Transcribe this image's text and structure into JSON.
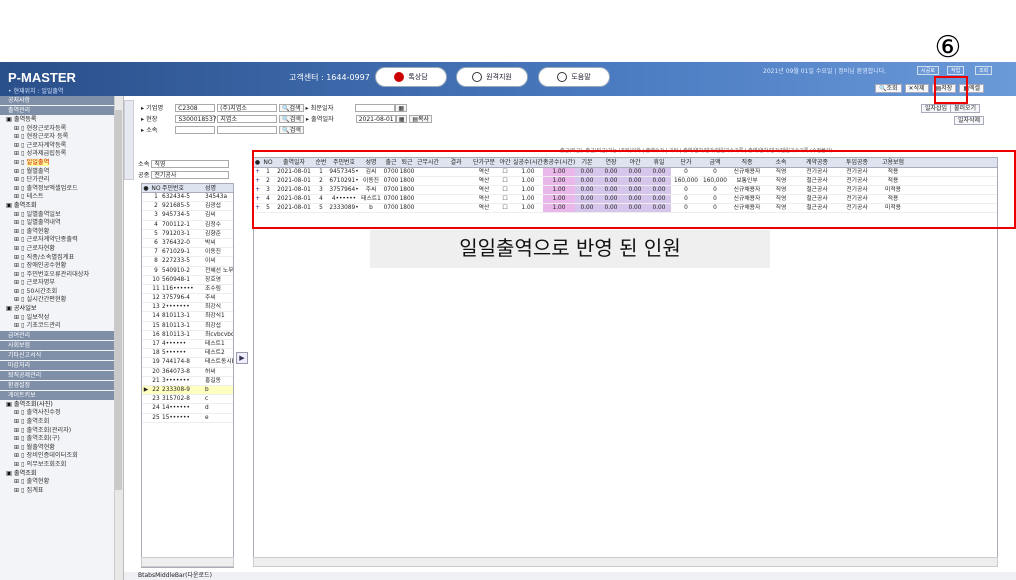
{
  "annotation": {
    "number": "⑥",
    "caption": "일일출역으로 반영 된 인원"
  },
  "header": {
    "app": "P-MASTER",
    "location": "• 현재위치 : 일일출역",
    "callcenter": "고객센터 : 1644-0997",
    "pills": [
      "톡상담",
      "원격지원",
      "도움말"
    ],
    "date": "2021년 09월 01일 수요일 | 정비님 환영합니다.",
    "btns": [
      "시공로",
      "작업",
      "조회"
    ]
  },
  "toolbar": {
    "search": "조회",
    "delete": "삭제",
    "save": "저장",
    "excel": "엑셀",
    "load": "불러오기",
    "rowdel": "일자삭제",
    "insert": "일자삽입"
  },
  "filters": {
    "company_label": "기업명",
    "company_code": "C2308",
    "company_name": "(주)지엽소",
    "site_label": "현장",
    "site_code": "S300018537",
    "site_name": "지엽소",
    "dept_label": "소속",
    "search": "검색",
    "date1_label": "최문일자",
    "date2_label": "출역일자",
    "date2": "2021-08-01",
    "copy": "복사"
  },
  "legend": "출근(퇴근), 출근(퇴근)가능 (조퇴)이하 | 출역수가 | 기타 | 출역/연차/반가/반일기수기록 | 출역/연차/반가/반일기수기록 (수정불가)",
  "left": {
    "dept_label": "소속",
    "dept_value": "직영",
    "trade_label": "공종",
    "trade_value": "전기공사",
    "cols": [
      "NO",
      "주민번호",
      "성명"
    ],
    "rows": [
      [
        "1",
        "632434-5",
        "34543a"
      ],
      [
        "2",
        "921685-5",
        "김광섭"
      ],
      [
        "3",
        "945734-5",
        "김씨"
      ],
      [
        "4",
        "700112-1",
        "김정수"
      ],
      [
        "5",
        "791203-1",
        "김향준"
      ],
      [
        "6",
        "376432-0",
        "박씨"
      ],
      [
        "7",
        "671029-1",
        "이동진"
      ],
      [
        "8",
        "227233-5",
        "이씨"
      ],
      [
        "9",
        "540910-2",
        "전혜선 노무"
      ],
      [
        "10",
        "560948-1",
        "장호영"
      ],
      [
        "11",
        "116••••••",
        "조수림"
      ],
      [
        "12",
        "375796-4",
        "주씨"
      ],
      [
        "13",
        "2•••••••",
        "최강식"
      ],
      [
        "14",
        "810113-1",
        "최강식1"
      ],
      [
        "15",
        "810113-1",
        "최강섭"
      ],
      [
        "16",
        "810113-1",
        "최cvbcvbcv"
      ],
      [
        "17",
        "4••••••",
        "테스트1"
      ],
      [
        "18",
        "5••••••",
        "테스트2"
      ],
      [
        "19",
        "744174-8",
        "테스트동시E"
      ],
      [
        "20",
        "364073-8",
        "허씨"
      ],
      [
        "21",
        "3•••••••",
        "홍길동"
      ],
      [
        "22",
        "233308-9",
        "b"
      ],
      [
        "23",
        "315702-8",
        "c"
      ],
      [
        "24",
        "14••••••",
        "d"
      ],
      [
        "25",
        "15••••••",
        "e"
      ]
    ]
  },
  "grid": {
    "cols": [
      "NO",
      "출역일자",
      "순번",
      "주민번호",
      "성명",
      "출근",
      "퇴근",
      "근무시간",
      "결과",
      "단가구분",
      "야간",
      "실공수(시간)",
      "총공수(시간)",
      "기본",
      "연장",
      "야간",
      "휴일",
      "단가",
      "금액",
      "직종",
      "소속",
      "계약공종",
      "투입공종",
      "고용보험"
    ],
    "rows": [
      [
        "1",
        "2021-08-01",
        "1",
        "9457345•",
        "김씨",
        "0700",
        "1800",
        "",
        "",
        "역산",
        "",
        "1.00",
        "1.00",
        "0.00",
        "0.00",
        "0.00",
        "0.00",
        "0",
        "0",
        "신규채용자",
        "직영",
        "전기공사",
        "전기공사",
        "적용"
      ],
      [
        "2",
        "2021-08-01",
        "2",
        "6710291•",
        "이동진",
        "0700",
        "1800",
        "",
        "",
        "역산",
        "",
        "1.00",
        "1.00",
        "0.00",
        "0.00",
        "0.00",
        "0.00",
        "160,000",
        "160,000",
        "보통인부",
        "직영",
        "철근공사",
        "전기공사",
        "적용"
      ],
      [
        "3",
        "2021-08-01",
        "3",
        "3757964•",
        "주씨",
        "0700",
        "1800",
        "",
        "",
        "역산",
        "",
        "1.00",
        "1.00",
        "0.00",
        "0.00",
        "0.00",
        "0.00",
        "0",
        "0",
        "신규채용자",
        "직영",
        "철근공사",
        "전기공사",
        "미적용"
      ],
      [
        "4",
        "2021-08-01",
        "4",
        "4••••••",
        "테스트1",
        "0700",
        "1800",
        "",
        "",
        "역산",
        "",
        "1.00",
        "1.00",
        "0.00",
        "0.00",
        "0.00",
        "0.00",
        "0",
        "0",
        "신규채용자",
        "직영",
        "철근공사",
        "전기공사",
        "적용"
      ],
      [
        "5",
        "2021-08-01",
        "5",
        "2333089•",
        "b",
        "0700",
        "1800",
        "",
        "",
        "역산",
        "",
        "1.00",
        "1.00",
        "0.00",
        "0.00",
        "0.00",
        "0.00",
        "0",
        "0",
        "신규채용자",
        "직영",
        "철근공사",
        "전기공사",
        "미적용"
      ]
    ]
  },
  "sidebar": [
    {
      "type": "head",
      "label": "공지사항"
    },
    {
      "type": "head",
      "label": "출역관리"
    },
    {
      "type": "group",
      "label": "출역등록"
    },
    {
      "type": "item",
      "label": "현장근로자등록"
    },
    {
      "type": "item",
      "label": "현장근로자 등록"
    },
    {
      "type": "item",
      "label": "근로자계약등록"
    },
    {
      "type": "item",
      "label": "성과제급립등록"
    },
    {
      "type": "item",
      "label": "일일출역",
      "hl": true
    },
    {
      "type": "item",
      "label": "월별출역"
    },
    {
      "type": "item",
      "label": "단가관리"
    },
    {
      "type": "item",
      "label": "출역정보엑셀업로드"
    },
    {
      "type": "item",
      "label": "테스트"
    },
    {
      "type": "group",
      "label": "출역조회"
    },
    {
      "type": "item",
      "label": "일별출역일보"
    },
    {
      "type": "item",
      "label": "일별출역내역"
    },
    {
      "type": "item",
      "label": "출역현황"
    },
    {
      "type": "item",
      "label": "근로자계약단종출력"
    },
    {
      "type": "item",
      "label": "근로자현황"
    },
    {
      "type": "item",
      "label": "직종/소속별집계표"
    },
    {
      "type": "item",
      "label": "장애인공수현황"
    },
    {
      "type": "item",
      "label": "주민번호오류관리대상자"
    },
    {
      "type": "item",
      "label": "근로자명부"
    },
    {
      "type": "item",
      "label": "50시간조회"
    },
    {
      "type": "item",
      "label": "실시간간편현황"
    },
    {
      "type": "group",
      "label": "공사일보"
    },
    {
      "type": "item",
      "label": "일보작성"
    },
    {
      "type": "item",
      "label": "기초코드관리"
    },
    {
      "type": "head",
      "label": "급여관리"
    },
    {
      "type": "head",
      "label": "사회보험"
    },
    {
      "type": "head",
      "label": "기타신고서식"
    },
    {
      "type": "head",
      "label": "마감처리"
    },
    {
      "type": "head",
      "label": "퇴직공제관리"
    },
    {
      "type": "head",
      "label": "환경설정"
    },
    {
      "type": "head",
      "label": "게이트키보"
    },
    {
      "type": "group",
      "label": "출역조회(사진)"
    },
    {
      "type": "item",
      "label": "출역사진수정"
    },
    {
      "type": "item",
      "label": "출역조회"
    },
    {
      "type": "item",
      "label": "출역조회(관리자)"
    },
    {
      "type": "item",
      "label": "출역조회(구)"
    },
    {
      "type": "item",
      "label": "월출역현황"
    },
    {
      "type": "item",
      "label": "장비인증데이터조회"
    },
    {
      "type": "item",
      "label": "의무보조회조회"
    },
    {
      "type": "group",
      "label": "출역조회"
    },
    {
      "type": "item",
      "label": "출역현황"
    },
    {
      "type": "item",
      "label": "집계표"
    }
  ],
  "bottom": "BtabsMiddleBar(다운로드)"
}
